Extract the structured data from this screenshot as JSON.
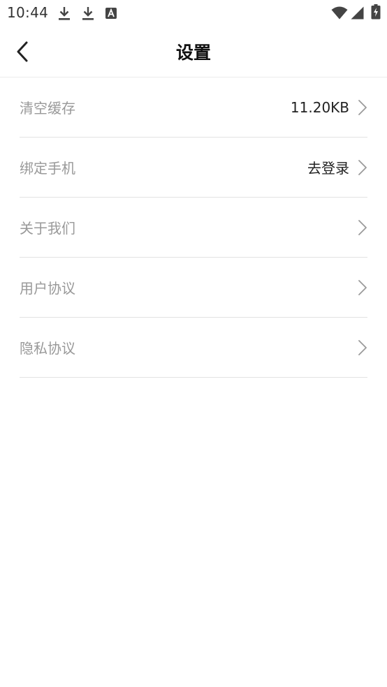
{
  "status_bar": {
    "time": "10:44",
    "icons": [
      "download-icon",
      "download-icon",
      "font-a-icon",
      "wifi-icon",
      "signal-icon",
      "battery-charging-icon"
    ]
  },
  "header": {
    "back_icon": "chevron-left-icon",
    "title": "设置"
  },
  "settings": {
    "items": [
      {
        "label": "清空缓存",
        "value": "11.20KB"
      },
      {
        "label": "绑定手机",
        "value": "去登录"
      },
      {
        "label": "关于我们",
        "value": ""
      },
      {
        "label": "用户协议",
        "value": ""
      },
      {
        "label": "隐私协议",
        "value": ""
      }
    ]
  },
  "colors": {
    "label": "#999999",
    "value": "#222222",
    "divider": "#e2e2e2",
    "chevron": "#9a9a9a"
  }
}
